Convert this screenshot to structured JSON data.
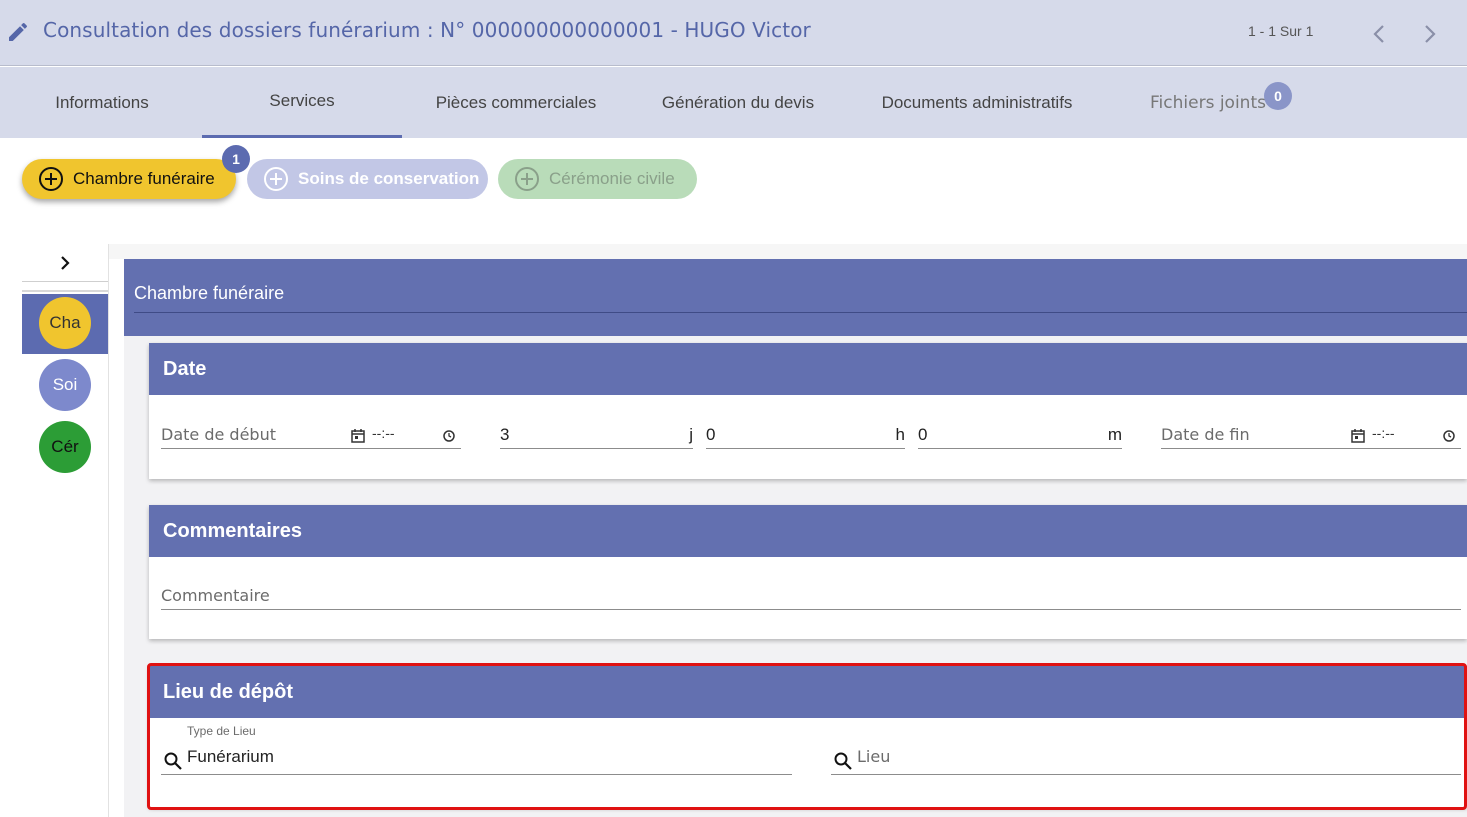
{
  "header": {
    "title": "Consultation des dossiers funérarium : N° 000000000000001 - HUGO Victor",
    "pager": "1 - 1 Sur 1",
    "icons": {
      "edit": "pencil-icon",
      "prev": "chevron-left-icon",
      "next": "chevron-right-icon"
    }
  },
  "tabs": [
    {
      "label": "Informations"
    },
    {
      "label": "Services",
      "active": true
    },
    {
      "label": "Pièces commerciales"
    },
    {
      "label": "Génération du devis"
    },
    {
      "label": "Documents administratifs"
    },
    {
      "label": "Fichiers joints",
      "badge": "0"
    }
  ],
  "chips": [
    {
      "label": "Chambre funéraire",
      "badge": "1",
      "color": "#f0c52e"
    },
    {
      "label": "Soins de conservation",
      "color": "#c2c7e6"
    },
    {
      "label": "Cérémonie civile",
      "color": "#b9dcb9"
    }
  ],
  "rail": {
    "toggle_icon": "chevron-right-icon",
    "items": [
      {
        "label": "Cha",
        "color": "#f0c52e"
      },
      {
        "label": "Soi",
        "color": "#7d89cc"
      },
      {
        "label": "Cér",
        "color": "#2c9d36"
      }
    ]
  },
  "section": {
    "title": "Chambre funéraire"
  },
  "date_card": {
    "title": "Date",
    "start_label": "Date de début",
    "start_time": "--:--",
    "days": {
      "value": "3",
      "unit": "j"
    },
    "hours": {
      "value": "0",
      "unit": "h"
    },
    "minutes": {
      "value": "0",
      "unit": "m"
    },
    "end_label": "Date de fin",
    "end_time": "--:--"
  },
  "comment_card": {
    "title": "Commentaires",
    "placeholder": "Commentaire"
  },
  "lieu_card": {
    "title": "Lieu de dépôt",
    "type_label": "Type de Lieu",
    "type_value": "Funérarium",
    "lieu_placeholder": "Lieu"
  },
  "colors": {
    "primary": "#6370b0",
    "header_bg": "#d6daea",
    "title": "#5566a8",
    "highlight": "#e01212"
  }
}
